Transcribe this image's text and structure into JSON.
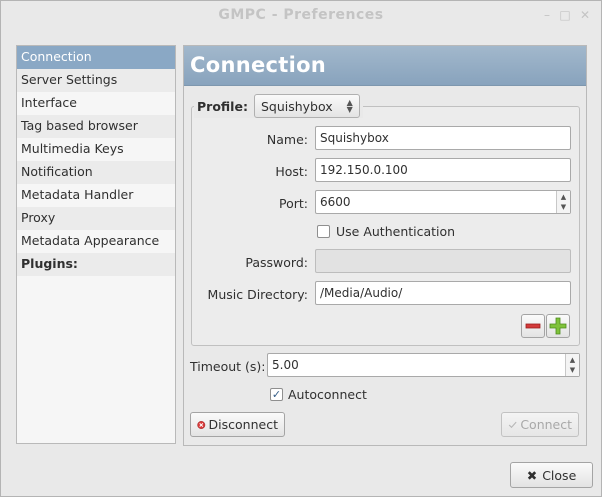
{
  "window": {
    "title": "GMPC - Preferences",
    "minimize_glyph": "–",
    "maximize_glyph": "□",
    "close_glyph": "✕"
  },
  "sidebar": {
    "items": [
      {
        "label": "Connection"
      },
      {
        "label": "Server Settings"
      },
      {
        "label": "Interface"
      },
      {
        "label": "Tag based browser"
      },
      {
        "label": "Multimedia Keys"
      },
      {
        "label": "Notification"
      },
      {
        "label": "Metadata Handler"
      },
      {
        "label": "Proxy"
      },
      {
        "label": "Metadata Appearance"
      },
      {
        "label": "Plugins:"
      }
    ]
  },
  "header": {
    "title": "Connection"
  },
  "profile": {
    "label": "Profile:",
    "selected": "Squishybox"
  },
  "form": {
    "name_label": "Name:",
    "name_value": "Squishybox",
    "host_label": "Host:",
    "host_value": "192.150.0.100",
    "port_label": "Port:",
    "port_value": "6600",
    "auth_label": "Use Authentication",
    "password_label": "Password:",
    "password_value": "",
    "music_dir_label": "Music Directory:",
    "music_dir_value": "/Media/Audio/"
  },
  "timeout": {
    "label": "Timeout (s):",
    "value": "5.00"
  },
  "autoconnect": {
    "label": "Autoconnect",
    "checked": true
  },
  "buttons": {
    "disconnect": "Disconnect",
    "connect": "Connect",
    "close": "Close"
  },
  "colors": {
    "selection": "#8aa8c5",
    "header_top": "#a2b8cc",
    "header_bottom": "#88a3bd",
    "remove_red": "#d33",
    "add_green": "#6aaa2a"
  }
}
